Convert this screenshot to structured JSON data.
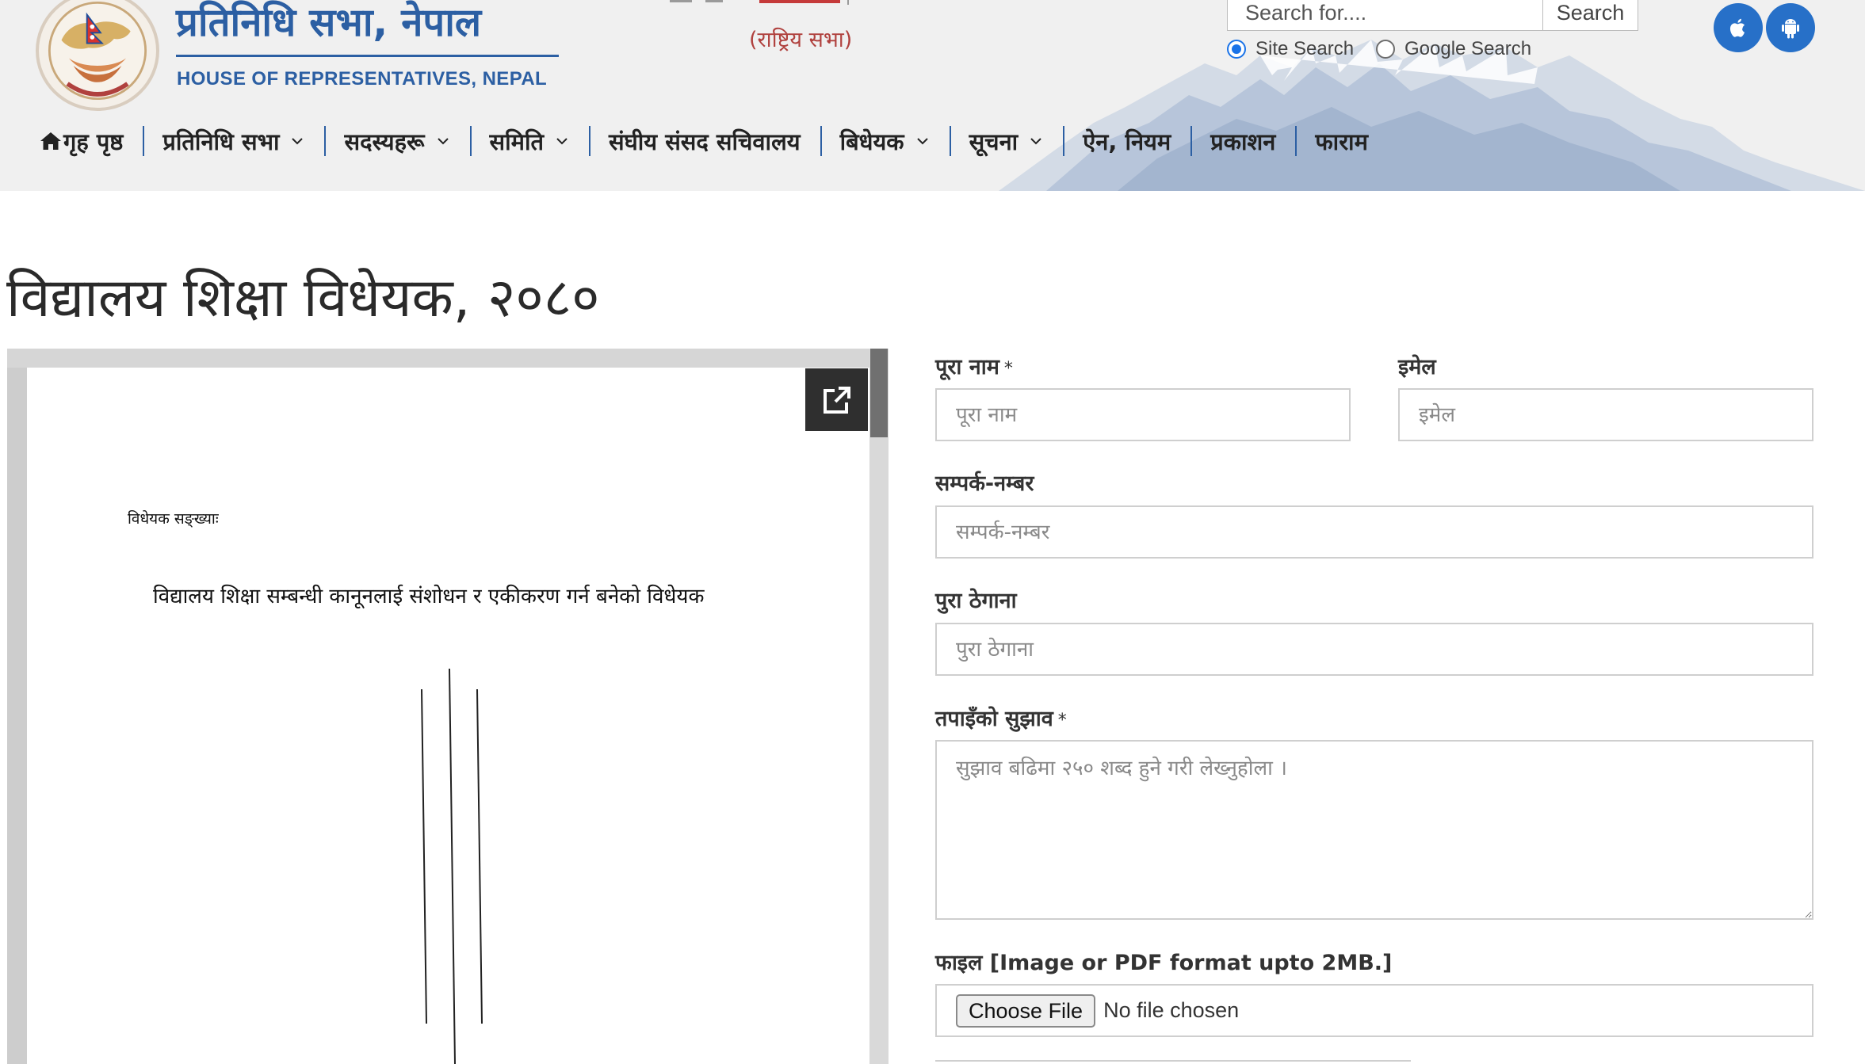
{
  "header": {
    "brand_nepali": "प्रतिनिधि सभा, नेपाल",
    "brand_english": "HOUSE OF REPRESENTATIVES, NEPAL",
    "upper_house_link": "(राष्ट्रिय सभा)",
    "search": {
      "placeholder": "Search for....",
      "button_label": "Search",
      "options": [
        {
          "label": "Site Search",
          "selected": true
        },
        {
          "label": "Google Search",
          "selected": false
        }
      ]
    },
    "app_links": [
      {
        "icon": "apple-icon"
      },
      {
        "icon": "android-icon"
      }
    ],
    "accent_color": "#2c5fa3",
    "upper_house_color": "#b0413e",
    "app_button_color": "#2770c8"
  },
  "nav": {
    "items": [
      {
        "label": "गृह पृष्ठ",
        "icon": "home-icon",
        "dropdown": false
      },
      {
        "label": "प्रतिनिधि सभा",
        "dropdown": true
      },
      {
        "label": "सदस्यहरू",
        "dropdown": true
      },
      {
        "label": "समिति",
        "dropdown": true
      },
      {
        "label": "संघीय संसद सचिवालय",
        "dropdown": false
      },
      {
        "label": "बिधेयक",
        "dropdown": true
      },
      {
        "label": "सूचना",
        "dropdown": true
      },
      {
        "label": "ऐन, नियम",
        "dropdown": false
      },
      {
        "label": "प्रकाशन",
        "dropdown": false
      },
      {
        "label": "फाराम",
        "dropdown": false
      }
    ]
  },
  "page": {
    "title": "विद्यालय शिक्षा विधेयक, २०८०"
  },
  "document_viewer": {
    "popout_icon": "external-link-icon",
    "bill_number_label": "विधेयक सङ्ख्याः",
    "bill_heading": "विद्यालय शिक्षा सम्बन्धी कानूनलाई संशोधन र एकीकरण गर्न बनेको विधेयक"
  },
  "form": {
    "full_name": {
      "label": "पूरा नाम",
      "required_mark": "*",
      "placeholder": "पूरा नाम",
      "value": ""
    },
    "email": {
      "label": "इमेल",
      "placeholder": "इमेल",
      "value": ""
    },
    "contact": {
      "label": "सम्पर्क-नम्बर",
      "placeholder": "सम्पर्क-नम्बर",
      "value": ""
    },
    "address": {
      "label": "पुरा ठेगाना",
      "placeholder": "पुरा ठेगाना",
      "value": ""
    },
    "suggestion": {
      "label": "तपाइँको सुझाव",
      "required_mark": "*",
      "placeholder": "सुझाव बढिमा २५० शब्द हुने गरी लेख्नुहोला ।",
      "value": ""
    },
    "file": {
      "label": "फाइल [Image or PDF format upto 2MB.]",
      "button_label": "Choose File",
      "status": "No file chosen"
    }
  }
}
